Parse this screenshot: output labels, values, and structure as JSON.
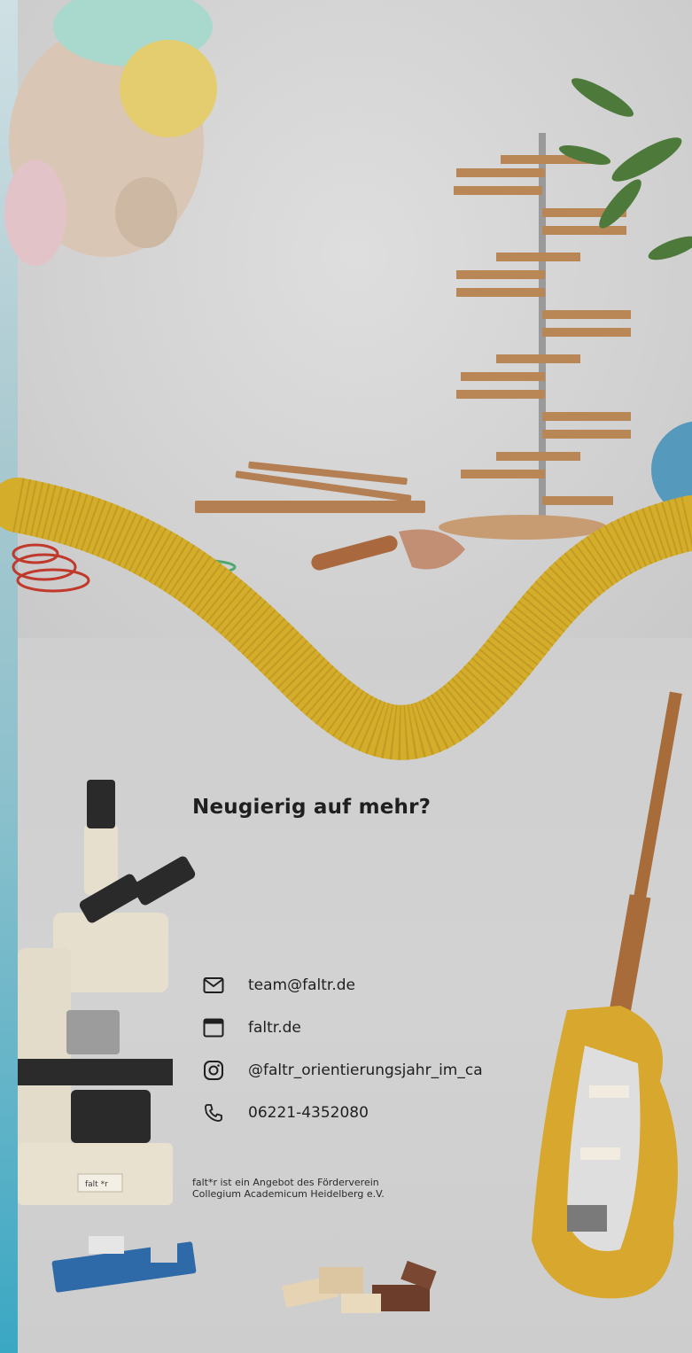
{
  "headline": "Neugierig auf mehr?",
  "contacts": [
    {
      "icon": "mail-icon",
      "text": "team@faltr.de"
    },
    {
      "icon": "browser-window-icon",
      "text": "faltr.de"
    },
    {
      "icon": "instagram-icon",
      "text": "@faltr_orientierungsjahr_im_ca"
    },
    {
      "icon": "phone-icon",
      "text": "06221-4352080"
    }
  ],
  "footer": {
    "line1": "falt*r ist ein Angebot des Förderverein",
    "line2": "Collegium Academicum Heidelberg e.V."
  },
  "microscope_label": "falt *r",
  "colors": {
    "background": "#cfd0d0",
    "text": "#1f1f1f",
    "accent_yellow": "#d4ad2a",
    "strip_teal": "#3aa7c3"
  }
}
